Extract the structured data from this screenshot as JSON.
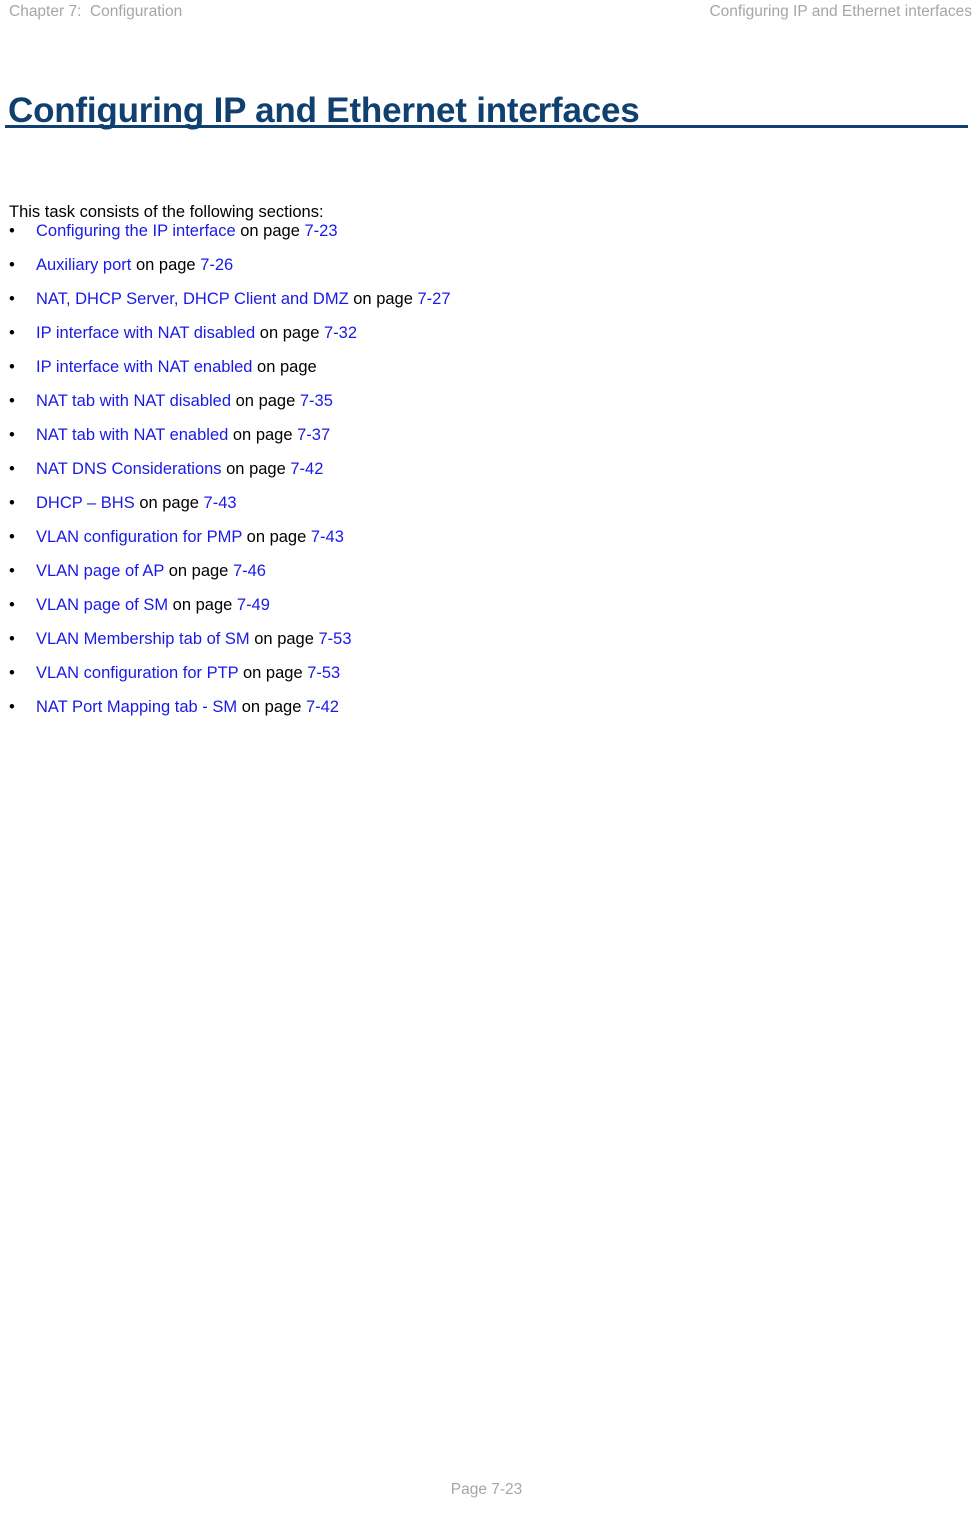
{
  "running_head": {
    "left": "Chapter 7:  Configuration",
    "right": "Configuring IP and Ethernet interfaces"
  },
  "title": "Configuring IP and Ethernet interfaces",
  "intro": "This task consists of the following sections:",
  "bullet_glyph": "•",
  "colors": {
    "title": "#10406f",
    "rule": "#10406f",
    "link": "#1a1ae6",
    "body_text": "#000000",
    "running_head": "#a6a6a6"
  },
  "sections": [
    {
      "link": "Configuring the IP interface",
      "mid": " on page ",
      "page": "7-23"
    },
    {
      "link": "Auxiliary port",
      "mid": " on page ",
      "page": "7-26"
    },
    {
      "link": "NAT, DHCP Server, DHCP Client and DMZ",
      "mid": " on page ",
      "page": "7-27"
    },
    {
      "link": "IP interface with NAT disabled",
      "mid": " on page ",
      "page": "7-32"
    },
    {
      "link": "IP interface with NAT enabled",
      "mid": " on page",
      "page": ""
    },
    {
      "link": "NAT tab with NAT disabled",
      "mid": " on page ",
      "page": "7-35"
    },
    {
      "link": "NAT tab with NAT enabled",
      "mid": " on page ",
      "page": "7-37"
    },
    {
      "link": "NAT DNS Considerations",
      "mid": " on page ",
      "page": "7-42"
    },
    {
      "link": "DHCP – BHS",
      "mid": " on page ",
      "page": "7-43"
    },
    {
      "link": "VLAN configuration for PMP",
      "mid": " on page ",
      "page": "7-43"
    },
    {
      "link": "VLAN page of AP",
      "mid": " on page ",
      "page": "7-46"
    },
    {
      "link": "VLAN page of SM",
      "mid": " on page ",
      "page": "7-49"
    },
    {
      "link": "VLAN Membership tab of SM",
      "mid": " on page ",
      "page": "7-53"
    },
    {
      "link": "VLAN configuration for PTP",
      "mid": " on page ",
      "page": "7-53"
    },
    {
      "link": "NAT Port Mapping tab - SM",
      "mid": " on page ",
      "page": "7-42"
    }
  ],
  "footer": {
    "page_label": "Page 7-23"
  }
}
